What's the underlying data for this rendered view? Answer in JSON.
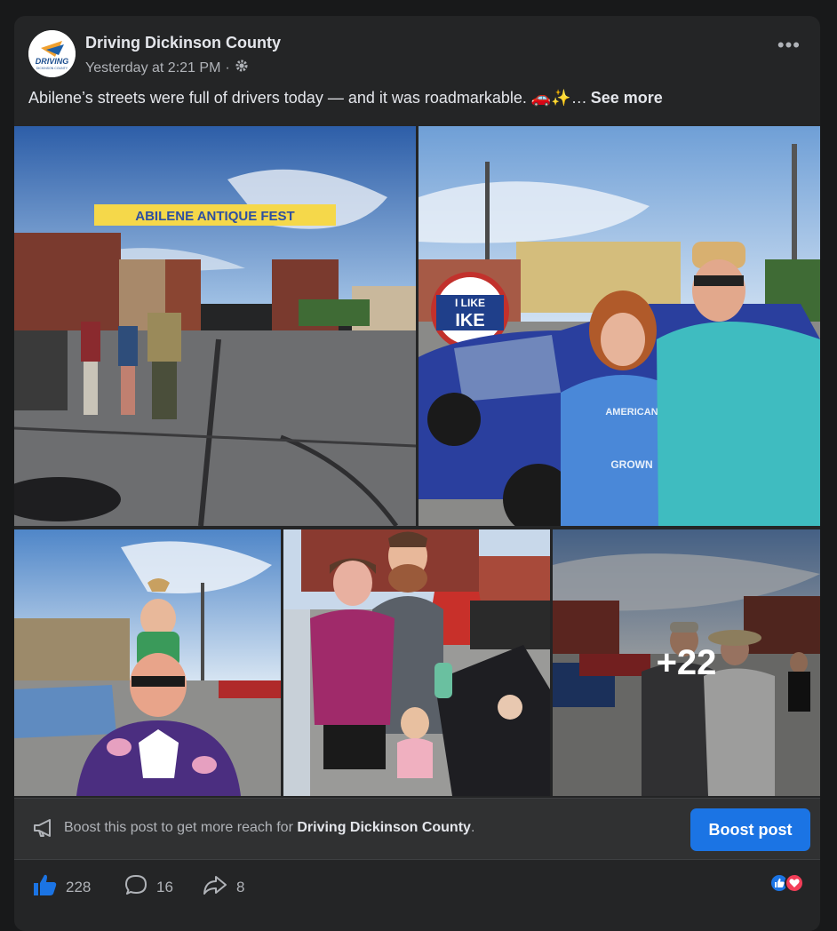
{
  "post": {
    "author": "Driving Dickinson County",
    "timestamp": "Yesterday at 2:21 PM",
    "separator": "·",
    "caption": "Abilene’s streets were full of drivers today — and it was roadmarkable. 🚗✨…",
    "see_more": "See more",
    "more_icon": "•••"
  },
  "avatar": {
    "logo_text": "DRIVING",
    "logo_subtext": "DICKINSON COUNTY"
  },
  "photos": {
    "banner_text": "ABILENE ANTIQUE FEST",
    "sign_line1": "I LIKE",
    "sign_line2": "IKE",
    "shirt_line1": "AMERICAN",
    "shirt_line2": "GROWN",
    "more_count": "+22"
  },
  "boost": {
    "text_prefix": "Boost this post to get more reach for ",
    "text_page": "Driving Dickinson County",
    "text_suffix": ".",
    "button_label": "Boost post"
  },
  "actions": {
    "likes": "228",
    "comments": "16",
    "shares": "8"
  },
  "colors": {
    "background": "#18191a",
    "card": "#242526",
    "accent": "#1b74e4",
    "love": "#f33e58"
  }
}
